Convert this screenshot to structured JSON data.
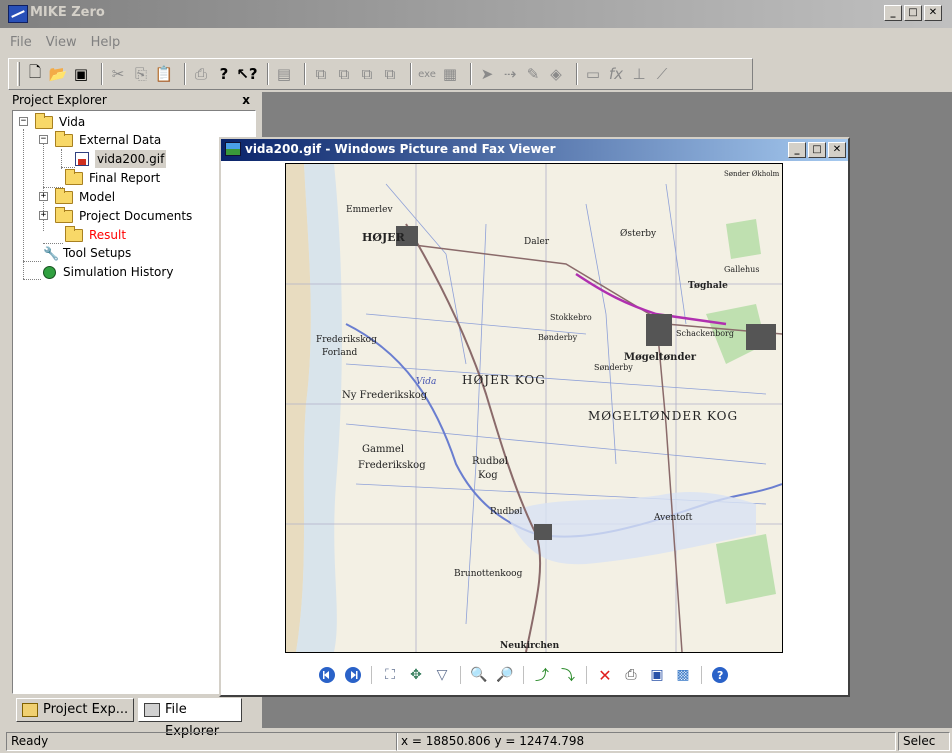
{
  "app": {
    "title": "MIKE Zero"
  },
  "menu": [
    "File",
    "View",
    "Help"
  ],
  "toolbar": {
    "groups": [
      [
        "new-file-icon",
        "open-folder-icon",
        "save-icon"
      ],
      [
        "cut-icon",
        "copy-icon",
        "paste-icon"
      ],
      [
        "print-icon",
        "help-icon",
        "context-help-icon"
      ],
      [
        "layout-icon"
      ],
      [
        "tool-a-icon",
        "tool-b-icon",
        "tool-c-icon",
        "tool-d-icon"
      ],
      [
        "exe-icon",
        "grid-icon"
      ],
      [
        "pointer-icon",
        "connect-icon",
        "pencil-icon",
        "node-icon"
      ],
      [
        "rectangle-icon",
        "function-icon",
        "marker-icon",
        "line-icon"
      ]
    ]
  },
  "project_explorer": {
    "title": "Project Explorer",
    "close": "x",
    "tree": {
      "root": "Vida",
      "external_data": "External Data",
      "file": "vida200.gif",
      "final_report": "Final Report",
      "model": "Model",
      "project_documents": "Project Documents",
      "result": "Result",
      "tool_setups": "Tool Setups",
      "simulation_history": "Simulation History"
    },
    "tabs": [
      "Project Exp...",
      "File Explorer"
    ]
  },
  "viewer": {
    "title": "vida200.gif - Windows Picture and Fax Viewer",
    "map_labels": {
      "town1": "HØJER",
      "town2": "Møgeltønder",
      "kog1": "HØJER KOG",
      "kog2": "MØGELTØNDER KOG",
      "place1": "Emmerlev",
      "place2": "Frederikskog",
      "place3": "Forland",
      "place4": "Ny Frederikskog",
      "place5": "Gammel",
      "place6": "Frederikskog",
      "place7": "Rudbøl",
      "place8": "Kog",
      "place9": "Rudbøl",
      "place10": "Brunottenkoog",
      "place11": "Aventoft",
      "place12": "Tøghale",
      "place13": "Stokkebro",
      "place14": "Schackenborg",
      "place15": "Daler",
      "place16": "Østerby",
      "place17": "Gallehus",
      "place18": "Sønder Økholm",
      "place19": "Neukirchen",
      "place20": "Vida",
      "place21": "Bønderby",
      "place22": "Sønderby"
    }
  },
  "status": {
    "ready": "Ready",
    "coords": "x = 18850.806  y = 12474.798",
    "mode": "Selec"
  },
  "colors": {
    "titlebar_inactive": "#808080",
    "viewer_title": "#0a246a",
    "mdi_bg": "#808080",
    "result_label": "#ff0000",
    "road_purple": "#b030b0"
  }
}
